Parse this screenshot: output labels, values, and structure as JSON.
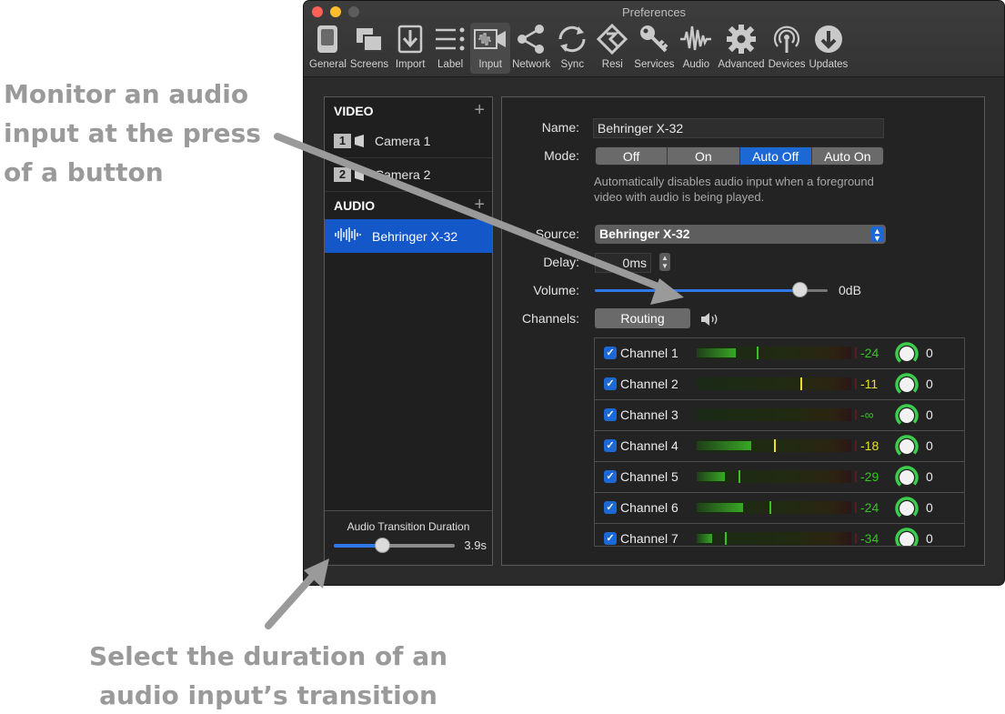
{
  "annotations": {
    "top": "Monitor an audio input at the press of a button",
    "bottom": "Select the duration of an audio input’s transition"
  },
  "window": {
    "title": "Preferences"
  },
  "toolbar": {
    "tabs": [
      {
        "label": "General",
        "icon": "general-icon"
      },
      {
        "label": "Screens",
        "icon": "screens-icon"
      },
      {
        "label": "Import",
        "icon": "import-icon"
      },
      {
        "label": "Label",
        "icon": "label-icon"
      },
      {
        "label": "Input",
        "icon": "input-icon",
        "active": true
      },
      {
        "label": "Network",
        "icon": "network-icon"
      },
      {
        "label": "Sync",
        "icon": "sync-icon"
      },
      {
        "label": "Resi",
        "icon": "resi-icon"
      },
      {
        "label": "Services",
        "icon": "key-icon"
      },
      {
        "label": "Audio",
        "icon": "waveform-icon"
      },
      {
        "label": "Advanced",
        "icon": "gear-icon"
      },
      {
        "label": "Devices",
        "icon": "devices-icon"
      },
      {
        "label": "Updates",
        "icon": "updates-icon"
      }
    ]
  },
  "sidebar": {
    "video_header": "VIDEO",
    "video_items": [
      {
        "number": "1",
        "label": "Camera 1"
      },
      {
        "number": "2",
        "label": "Camera 2"
      }
    ],
    "audio_header": "AUDIO",
    "audio_items": [
      {
        "label": "Behringer X-32",
        "selected": true
      }
    ],
    "add_symbol": "+",
    "transition": {
      "label": "Audio Transition Duration",
      "value_text": "3.9s",
      "level": 0.4
    }
  },
  "main": {
    "name_label": "Name:",
    "name_value": "Behringer X-32",
    "mode_label": "Mode:",
    "mode_options": [
      "Off",
      "On",
      "Auto Off",
      "Auto On"
    ],
    "mode_selected": "Auto Off",
    "mode_help": "Automatically disables audio input when a foreground video with audio is being played.",
    "source_label": "Source:",
    "source_value": "Behringer X-32",
    "delay_label": "Delay:",
    "delay_value": "0ms",
    "volume_label": "Volume:",
    "volume_value_text": "0dB",
    "volume_level": 0.88,
    "channels_label": "Channels:",
    "routing_label": "Routing",
    "channels": [
      {
        "label": "Channel 1",
        "checked": true,
        "db": "-24",
        "gain": "0",
        "level": 0.25,
        "peak": 0.39
      },
      {
        "label": "Channel 2",
        "checked": true,
        "db": "-11",
        "gain": "0",
        "level": 0.0,
        "peak": 0.67
      },
      {
        "label": "Channel 3",
        "checked": true,
        "db": "-∞",
        "gain": "0",
        "level": 0.0,
        "peak": null
      },
      {
        "label": "Channel 4",
        "checked": true,
        "db": "-18",
        "gain": "0",
        "level": 0.35,
        "peak": 0.5
      },
      {
        "label": "Channel 5",
        "checked": true,
        "db": "-29",
        "gain": "0",
        "level": 0.18,
        "peak": 0.27
      },
      {
        "label": "Channel 6",
        "checked": true,
        "db": "-24",
        "gain": "0",
        "level": 0.3,
        "peak": 0.47
      },
      {
        "label": "Channel 7",
        "checked": true,
        "db": "-34",
        "gain": "0",
        "level": 0.1,
        "peak": 0.18
      }
    ]
  },
  "colors": {
    "accent": "#1c69d6",
    "meter_green": "#39c126",
    "meter_yellow": "#e8e02a",
    "annotation_gray": "#9a9a9a"
  }
}
